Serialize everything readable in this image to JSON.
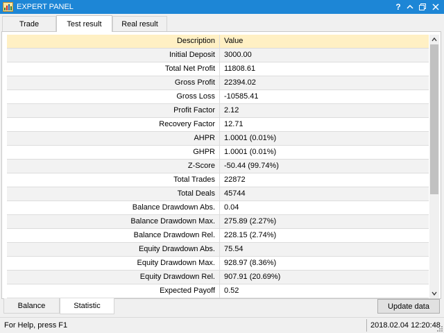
{
  "window": {
    "title": "EXPERT PANEL",
    "controls": [
      "help-icon",
      "collapse-icon",
      "restore-icon",
      "close-icon"
    ],
    "help_label": "?",
    "accent_color": "#1d86d6"
  },
  "top_tabs": [
    {
      "label": "Trade",
      "active": false
    },
    {
      "label": "Test result",
      "active": true
    },
    {
      "label": "Real result",
      "active": false
    }
  ],
  "table": {
    "columns": [
      "Description",
      "Value"
    ],
    "header_color": "#fff0c4",
    "rows": [
      {
        "description": "Initial Deposit",
        "value": "3000.00"
      },
      {
        "description": "Total Net Profit",
        "value": "11808.61"
      },
      {
        "description": "Gross Profit",
        "value": "22394.02"
      },
      {
        "description": "Gross Loss",
        "value": "-10585.41"
      },
      {
        "description": "Profit Factor",
        "value": "2.12"
      },
      {
        "description": "Recovery Factor",
        "value": "12.71"
      },
      {
        "description": "AHPR",
        "value": "1.0001 (0.01%)"
      },
      {
        "description": "GHPR",
        "value": "1.0001 (0.01%)"
      },
      {
        "description": "Z-Score",
        "value": "-50.44 (99.74%)"
      },
      {
        "description": "Total Trades",
        "value": "22872"
      },
      {
        "description": "Total Deals",
        "value": "45744"
      },
      {
        "description": "Balance Drawdown Abs.",
        "value": "0.04"
      },
      {
        "description": "Balance Drawdown Max.",
        "value": "275.89 (2.27%)"
      },
      {
        "description": "Balance Drawdown Rel.",
        "value": "228.15 (2.74%)"
      },
      {
        "description": "Equity Drawdown Abs.",
        "value": "75.54"
      },
      {
        "description": "Equity Drawdown Max.",
        "value": "928.97 (8.36%)"
      },
      {
        "description": "Equity Drawdown Rel.",
        "value": "907.91 (20.69%)"
      },
      {
        "description": "Expected Payoff",
        "value": "0.52"
      }
    ]
  },
  "bottom_tabs": [
    {
      "label": "Balance",
      "active": false
    },
    {
      "label": "Statistic",
      "active": true
    }
  ],
  "update_button": "Update data",
  "status": {
    "help_text": "For Help, press F1",
    "datetime": "2018.02.04 12:20:48"
  }
}
